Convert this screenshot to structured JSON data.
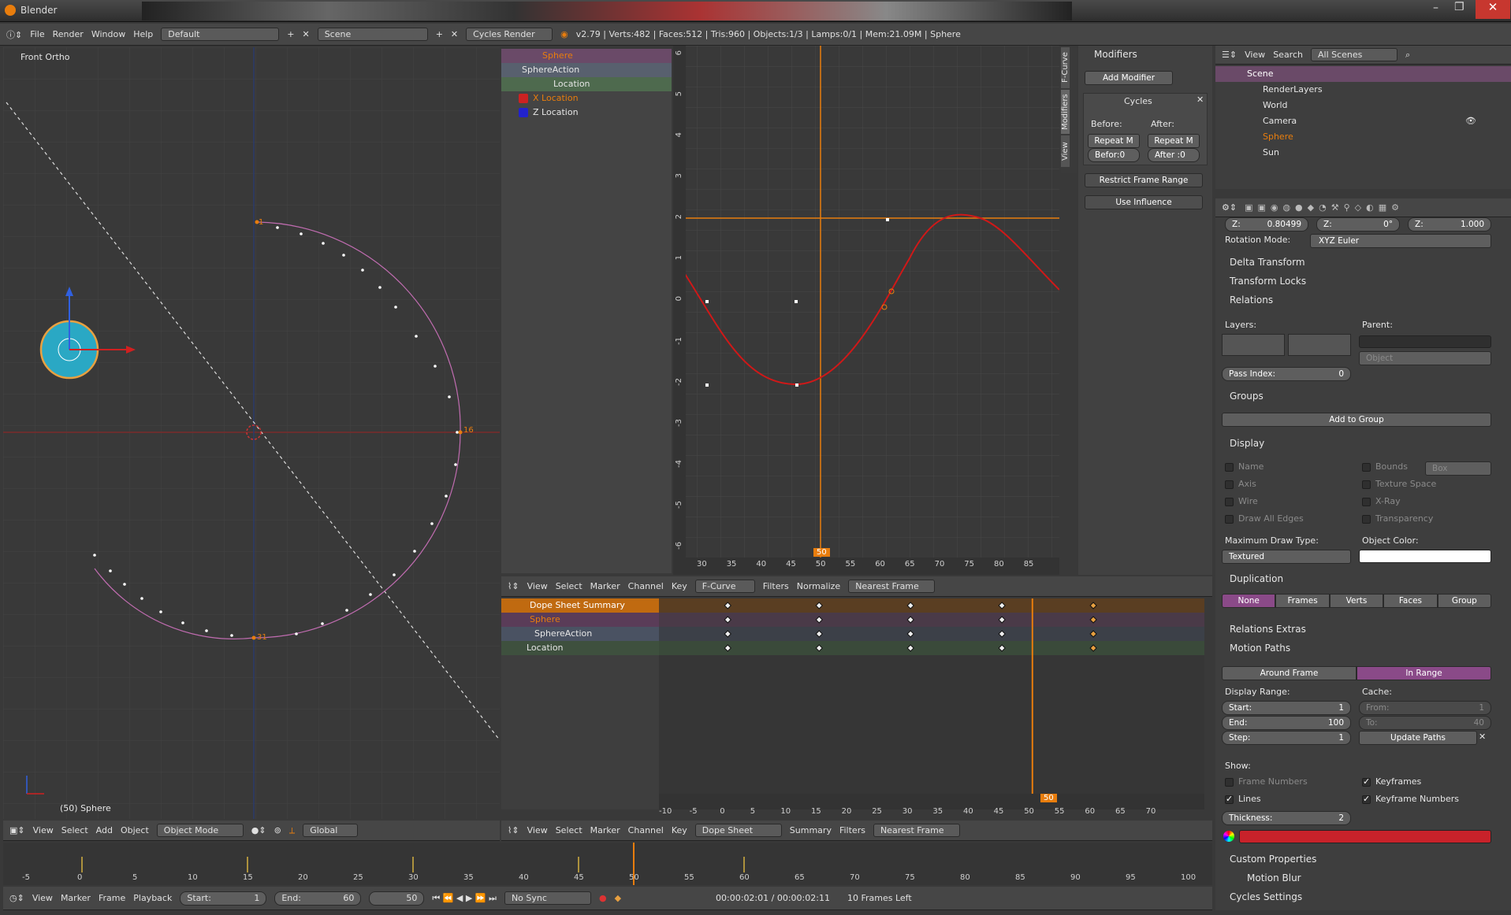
{
  "window": {
    "title": "Blender"
  },
  "info_bar": {
    "menus": [
      "File",
      "Render",
      "Window",
      "Help"
    ],
    "layout": "Default",
    "scene": "Scene",
    "engine": "Cycles Render",
    "stats": "v2.79 | Verts:482 | Faces:512 | Tris:960 | Objects:1/3 | Lamps:0/1 | Mem:21.09M | Sphere"
  },
  "viewport": {
    "label": "Front Ortho",
    "object_label": "(50) Sphere",
    "path_labels": [
      "1",
      "16",
      "31"
    ],
    "header": {
      "menus": [
        "View",
        "Select",
        "Add",
        "Object"
      ],
      "mode": "Object Mode",
      "orientation": "Global"
    }
  },
  "graph_editor": {
    "channels": [
      {
        "name": "Sphere",
        "kind": "object"
      },
      {
        "name": "SphereAction",
        "kind": "action"
      },
      {
        "name": "Location",
        "kind": "group"
      },
      {
        "name": "X Location",
        "kind": "xcurve"
      },
      {
        "name": "Z Location",
        "kind": "zcurve"
      }
    ],
    "y_ticks": [
      "6",
      "5",
      "4",
      "3",
      "2",
      "1",
      "0",
      "-1",
      "-2",
      "-3",
      "-4",
      "-5",
      "-6"
    ],
    "x_ticks": [
      "30",
      "35",
      "40",
      "45",
      "50",
      "55",
      "60",
      "65",
      "70",
      "75",
      "80",
      "85"
    ],
    "current_frame": "50",
    "tabs": [
      "F-Curve",
      "Modifiers",
      "View"
    ],
    "header": {
      "menus": [
        "View",
        "Select",
        "Marker",
        "Channel",
        "Key"
      ],
      "mode": "F-Curve",
      "filters": "Filters",
      "normalize": "Normalize",
      "snap": "Nearest Frame"
    }
  },
  "modifiers_panel": {
    "title": "Modifiers",
    "add_modifier": "Add Modifier",
    "cycles": "Cycles",
    "before_label": "Before:",
    "after_label": "After:",
    "before_mode": "Repeat M",
    "after_mode": "Repeat M",
    "before_count": "Befor:0",
    "after_count": "After :0",
    "restrict": "Restrict Frame Range",
    "influence": "Use Influence"
  },
  "dopesheet": {
    "channels": [
      {
        "name": "Dope Sheet Summary"
      },
      {
        "name": "Sphere"
      },
      {
        "name": "SphereAction"
      },
      {
        "name": "Location"
      }
    ],
    "x_ticks": [
      "-10",
      "-5",
      "0",
      "5",
      "10",
      "15",
      "20",
      "25",
      "30",
      "35",
      "40",
      "45",
      "50",
      "55",
      "60",
      "65",
      "70"
    ],
    "current_frame": "50",
    "keyframes": [
      0,
      15,
      30,
      45,
      60
    ],
    "header": {
      "menus": [
        "View",
        "Select",
        "Marker",
        "Channel",
        "Key"
      ],
      "mode": "Dope Sheet",
      "summary": "Summary",
      "filters": "Filters",
      "snap": "Nearest Frame"
    }
  },
  "timeline": {
    "ticks": [
      "-5",
      "0",
      "5",
      "10",
      "15",
      "20",
      "25",
      "30",
      "35",
      "40",
      "45",
      "50",
      "55",
      "60",
      "65",
      "70",
      "75",
      "80",
      "85",
      "90",
      "95",
      "100"
    ],
    "keyframes": [
      0,
      15,
      30,
      45,
      60
    ],
    "current": 50,
    "header": {
      "menus": [
        "View",
        "Marker",
        "Frame",
        "Playback"
      ],
      "start_label": "Start:",
      "start": "1",
      "end_label": "End:",
      "end": "60",
      "frame": "50",
      "sync": "No Sync",
      "time": "00:00:02:01 / 00:00:02:11",
      "frames_left": "10 Frames Left"
    }
  },
  "outliner": {
    "menus": [
      "View",
      "Search"
    ],
    "scope": "All Scenes",
    "items": [
      {
        "name": "Scene",
        "level": 0
      },
      {
        "name": "RenderLayers",
        "level": 1
      },
      {
        "name": "World",
        "level": 1
      },
      {
        "name": "Camera",
        "level": 1
      },
      {
        "name": "Sphere",
        "level": 1
      },
      {
        "name": "Sun",
        "level": 1
      }
    ]
  },
  "properties": {
    "z_fields": [
      {
        "label": "Z:",
        "value": "0.80499"
      },
      {
        "label": "Z:",
        "value": "0°"
      },
      {
        "label": "Z:",
        "value": "1.000"
      }
    ],
    "rotation_mode_label": "Rotation Mode:",
    "rotation_mode": "XYZ Euler",
    "delta_transform": "Delta Transform",
    "transform_locks": "Transform Locks",
    "relations": "Relations",
    "layers_label": "Layers:",
    "parent_label": "Parent:",
    "parent_type": "Object",
    "pass_index_label": "Pass Index:",
    "pass_index": "0",
    "groups": "Groups",
    "add_to_group": "Add to Group",
    "display": "Display",
    "display_checks_left": [
      "Name",
      "Axis",
      "Wire",
      "Draw All Edges"
    ],
    "display_checks_right": [
      "Bounds",
      "Texture Space",
      "X-Ray",
      "Transparency"
    ],
    "bounds_type": "Box",
    "max_draw_label": "Maximum Draw Type:",
    "max_draw": "Textured",
    "object_color_label": "Object Color:",
    "duplication": "Duplication",
    "dup_tabs": [
      "None",
      "Frames",
      "Verts",
      "Faces",
      "Group"
    ],
    "relations_extras": "Relations Extras",
    "motion_paths": "Motion Paths",
    "mp_tabs": [
      "Around Frame",
      "In Range"
    ],
    "display_range_label": "Display Range:",
    "cache_label": "Cache:",
    "start_label": "Start:",
    "start": "1",
    "end_label": "End:",
    "end": "100",
    "step_label": "Step:",
    "step": "1",
    "from_label": "From:",
    "from": "1",
    "to_label": "To:",
    "to": "40",
    "update_paths": "Update Paths",
    "show_label": "Show:",
    "frame_numbers": "Frame Numbers",
    "keyframes": "Keyframes",
    "lines": "Lines",
    "keyframe_numbers": "Keyframe Numbers",
    "thickness_label": "Thickness:",
    "thickness": "2",
    "custom_properties": "Custom Properties",
    "motion_blur": "Motion Blur",
    "cycles_settings": "Cycles Settings",
    "path_color": "#c8222a"
  }
}
